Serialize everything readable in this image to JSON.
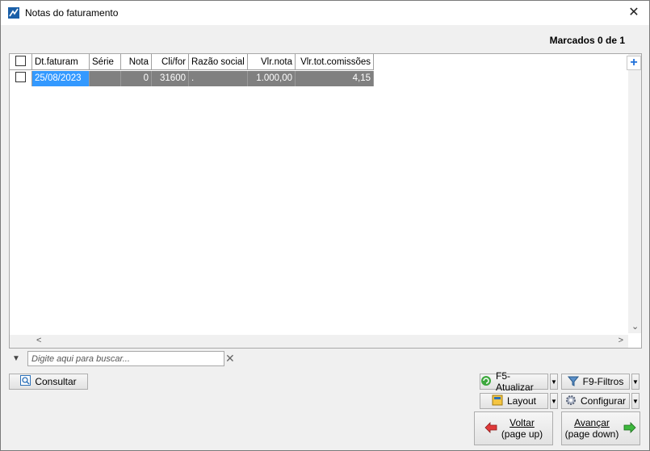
{
  "window": {
    "title": "Notas do faturamento",
    "close_glyph": "✕"
  },
  "status": {
    "marked": "Marcados 0 de 1"
  },
  "grid": {
    "columns": [
      "Dt.faturam",
      "Série",
      "Nota",
      "Cli/for",
      "Razão social",
      "Vlr.nota",
      "Vlr.tot.comissões"
    ],
    "rows": [
      {
        "dt_faturam": "25/08/2023",
        "serie": "",
        "nota": "0",
        "cli_for": "31600",
        "razao_social": ".",
        "vlr_nota": "1.000,00",
        "vlr_tot_comissoes": "4,15"
      }
    ]
  },
  "search": {
    "placeholder": "Digite aqui para buscar..."
  },
  "buttons": {
    "consultar": "Consultar",
    "atualizar": "F5-Atualizar",
    "filtros": "F9-Filtros",
    "layout": "Layout",
    "configurar": "Configurar",
    "voltar_line1": "Voltar",
    "voltar_line2": "(page up)",
    "avancar_line1": "Avançar",
    "avancar_line2": "(page down)"
  },
  "icons": {
    "app": "app-icon",
    "plus": "plus-icon",
    "filter": "filter-icon"
  },
  "colors": {
    "selected_cell": "#3399ff",
    "row_bg": "#808080",
    "add_blue": "#1e6fd9"
  }
}
